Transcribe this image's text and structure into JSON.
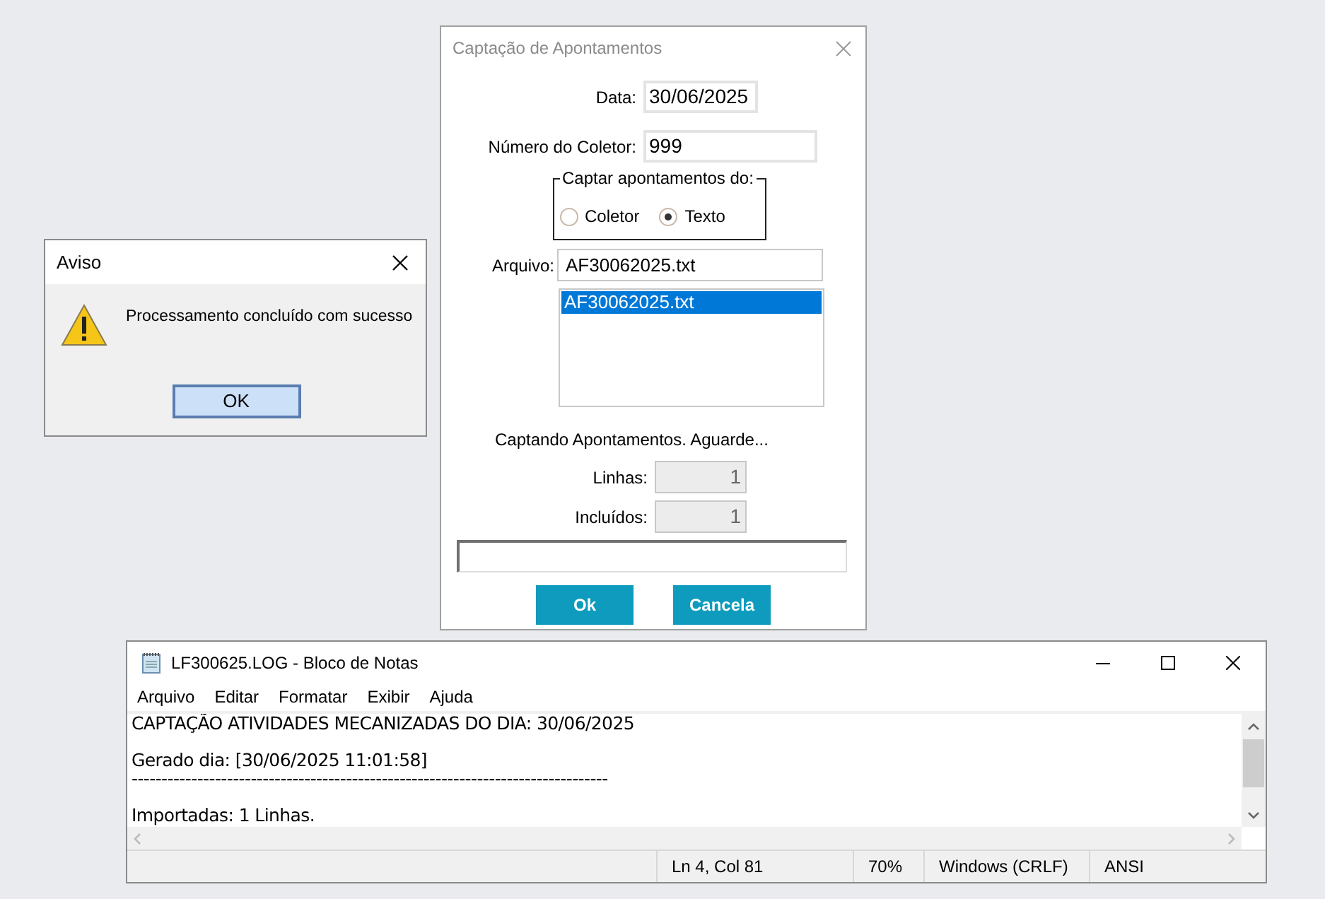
{
  "alert": {
    "title": "Aviso",
    "message": "Processamento concluído com sucesso",
    "button": "OK"
  },
  "capture_dialog": {
    "title": "Captação de Apontamentos",
    "fields": [
      {
        "label": "Data:",
        "value": "30/06/2025"
      },
      {
        "label": "Número do Coletor:",
        "value": "999"
      }
    ],
    "source_group": {
      "legend": "Captar apontamentos do:",
      "options": [
        {
          "label": "Coletor",
          "selected": false
        },
        {
          "label": "Texto",
          "selected": true
        }
      ]
    },
    "file": {
      "label": "Arquivo:",
      "value": "AF30062025.txt"
    },
    "file_list": [
      {
        "name": "AF30062025.txt",
        "selected": true
      }
    ],
    "status": "Captando Apontamentos. Aguarde...",
    "counters": [
      {
        "label": "Linhas:",
        "value": "1",
        "disabled": true
      },
      {
        "label": "Incluídos:",
        "value": "1",
        "disabled": true
      }
    ],
    "progress": {
      "level": 0
    },
    "buttons": [
      "Ok",
      "Cancela"
    ]
  },
  "notepad": {
    "title": "LF300625.LOG - Bloco de Notas",
    "menu": [
      "Arquivo",
      "Editar",
      "Formatar",
      "Exibir",
      "Ajuda"
    ],
    "paragraphs": [
      [
        "CAPTAÇÃO ATIVIDADES MECANIZADAS DO DIA: 30/06/2025"
      ],
      [
        "Gerado dia: [30/06/2025 11:01:58]",
        "--------------------------------------------------------------------------------"
      ],
      [
        "Importadas: 1 Linhas."
      ]
    ],
    "status_bar": [
      "Ln 4, Col 81",
      "70%",
      "Windows (CRLF)",
      "ANSI"
    ]
  }
}
